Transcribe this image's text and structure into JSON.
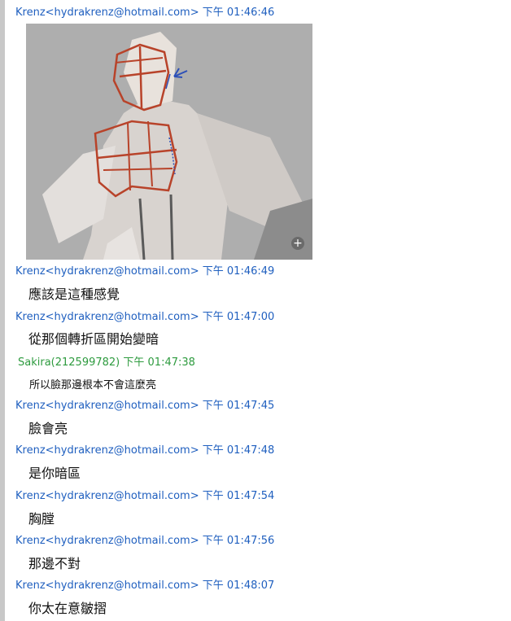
{
  "chat": {
    "attachment": {
      "zoom_icon": "zoom-in-icon",
      "zoom_glyph": "+"
    },
    "messages": [
      {
        "sender": "Krenz<hydrakrenz@hotmail.com>",
        "time": "下午 01:46:46",
        "text": ""
      },
      {
        "sender": "Krenz<hydrakrenz@hotmail.com>",
        "time": "下午 01:46:49",
        "text": "應該是這種感覺"
      },
      {
        "sender": "Krenz<hydrakrenz@hotmail.com>",
        "time": "下午 01:47:00",
        "text": "從那個轉折區開始變暗"
      },
      {
        "sender": "Sakira(212599782)",
        "time": "下午 01:47:38",
        "text": "所以臉那邊根本不會這麼亮"
      },
      {
        "sender": "Krenz<hydrakrenz@hotmail.com>",
        "time": "下午 01:47:45",
        "text": "臉會亮"
      },
      {
        "sender": "Krenz<hydrakrenz@hotmail.com>",
        "time": "下午 01:47:48",
        "text": "是你暗區"
      },
      {
        "sender": "Krenz<hydrakrenz@hotmail.com>",
        "time": "下午 01:47:54",
        "text": "胸膛"
      },
      {
        "sender": "Krenz<hydrakrenz@hotmail.com>",
        "time": "下午 01:47:56",
        "text": "那邊不對"
      },
      {
        "sender": "Krenz<hydrakrenz@hotmail.com>",
        "time": "下午 01:48:07",
        "text": "你太在意皺摺"
      }
    ]
  }
}
